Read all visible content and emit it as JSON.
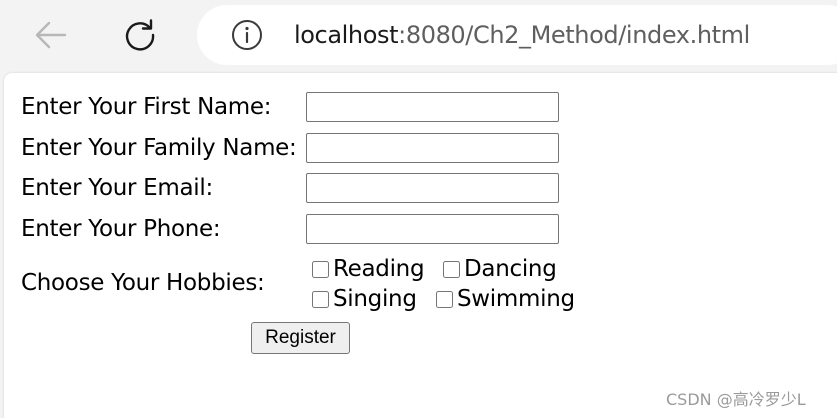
{
  "browser": {
    "url_host": "localhost",
    "url_path": ":8080/Ch2_Method/index.html",
    "back_icon": "arrow-left-icon",
    "refresh_icon": "refresh-icon",
    "info_icon": "info-icon"
  },
  "form": {
    "first_name_label": "Enter Your First Name:",
    "family_name_label": "Enter Your Family Name:",
    "email_label": "Enter Your Email:",
    "phone_label": "Enter Your Phone:",
    "first_name_value": "",
    "family_name_value": "",
    "email_value": "",
    "phone_value": "",
    "hobbies_label": "Choose Your Hobbies:",
    "hobbies": [
      "Reading",
      "Dancing",
      "Singing",
      "Swimming"
    ],
    "register_label": "Register"
  },
  "watermark": "CSDN @高冷罗少L"
}
